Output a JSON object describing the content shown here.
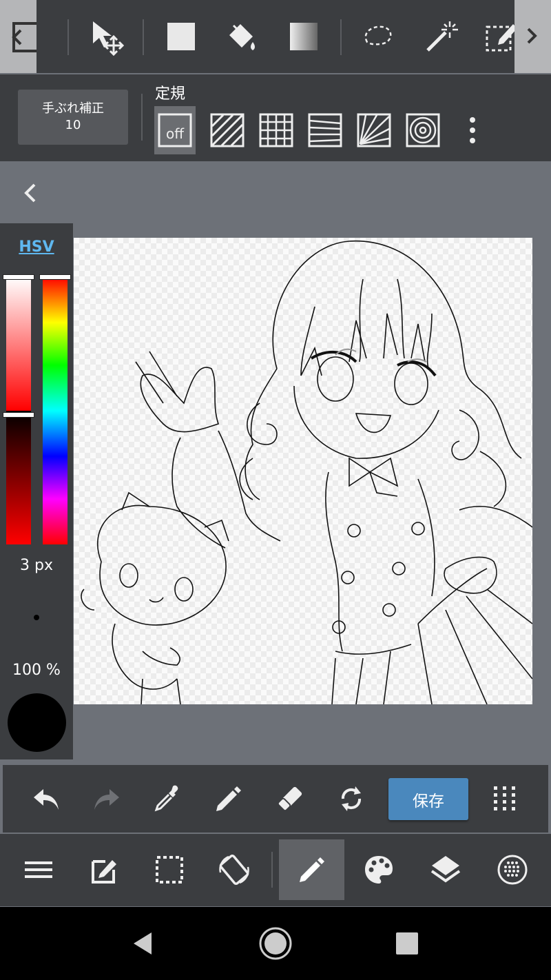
{
  "top_toolbar": {
    "tools": [
      "prev-icon",
      "transform-icon",
      "fill-square-icon",
      "bucket-icon",
      "gradient-icon",
      "lasso-icon",
      "magic-wand-icon",
      "select-pen-icon",
      "next-icon"
    ]
  },
  "stabilizer": {
    "label": "手ぶれ補正",
    "value": "10"
  },
  "ruler": {
    "title": "定規",
    "off_label": "off",
    "options": [
      "off",
      "parallel-lines",
      "grid",
      "perspective",
      "radial-lines",
      "concentric-circles"
    ]
  },
  "color_panel": {
    "mode_label": "HSV",
    "brush_size": "3 px",
    "opacity": "100 %",
    "current_color": "#000000",
    "hue_color": "#ff0000"
  },
  "canvas": {
    "content": "line-art-illustration"
  },
  "action_bar": {
    "save_label": "保存",
    "tools": [
      "undo-icon",
      "redo-icon",
      "eyedropper-icon",
      "pen-icon",
      "eraser-icon",
      "rotate-icon",
      "save-button",
      "grid-menu-icon"
    ]
  },
  "main_bar": {
    "tools": [
      "menu-icon",
      "edit-icon",
      "selection-icon",
      "canvas-rotate-icon",
      "brush-icon",
      "palette-icon",
      "layers-icon",
      "material-icon"
    ],
    "active": "brush-icon"
  },
  "nav_bar": {
    "buttons": [
      "back-icon",
      "home-icon",
      "recents-icon"
    ]
  }
}
